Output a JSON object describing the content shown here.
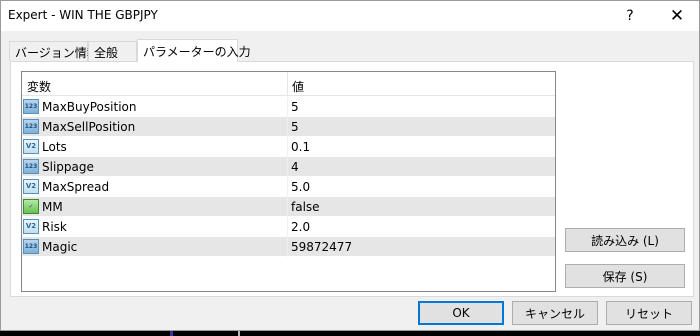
{
  "window": {
    "title": "Expert - WIN THE GBPJPY",
    "help_glyph": "?",
    "close_glyph": "✕"
  },
  "tabs": [
    {
      "label": "バージョン情報"
    },
    {
      "label": "全般"
    },
    {
      "label": "パラメーターの入力"
    }
  ],
  "grid": {
    "headers": {
      "variable": "変数",
      "value": "値"
    },
    "rows": [
      {
        "type_icon": "integer-icon",
        "icon_text": "123",
        "name": "MaxBuyPosition",
        "value": "5"
      },
      {
        "type_icon": "integer-icon",
        "icon_text": "123",
        "name": "MaxSellPosition",
        "value": "5"
      },
      {
        "type_icon": "double-icon",
        "icon_text": "V2",
        "name": "Lots",
        "value": "0.1"
      },
      {
        "type_icon": "integer-icon",
        "icon_text": "123",
        "name": "Slippage",
        "value": "4"
      },
      {
        "type_icon": "double-icon",
        "icon_text": "V2",
        "name": "MaxSpread",
        "value": "5.0"
      },
      {
        "type_icon": "boolean-icon",
        "icon_text": "✓",
        "name": "MM",
        "value": "false"
      },
      {
        "type_icon": "double-icon",
        "icon_text": "V2",
        "name": "Risk",
        "value": "2.0"
      },
      {
        "type_icon": "integer-icon",
        "icon_text": "123",
        "name": "Magic",
        "value": "59872477"
      }
    ]
  },
  "buttons": {
    "load": "読み込み (L)",
    "save": "保存 (S)",
    "ok": "OK",
    "cancel": "キャンセル",
    "reset": "リセット"
  },
  "colors": {
    "accent_focus": "#0078d7",
    "row_alt": "#e6e6e6"
  }
}
